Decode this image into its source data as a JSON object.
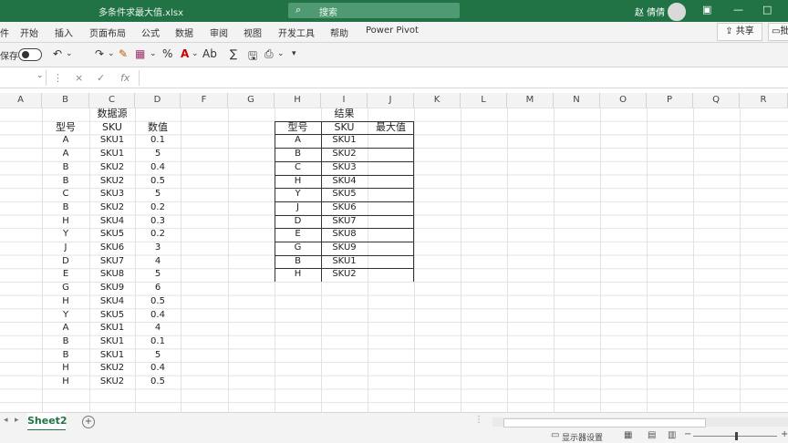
{
  "titlebar": {
    "filename": "多条件求最大值.xlsx",
    "search_placeholder": "搜索",
    "user_name": "赵 倩倩",
    "window_buttons": [
      "restore-icon",
      "minimize-icon",
      "maximize-icon"
    ]
  },
  "ribbon_tabs": [
    "件",
    "开始",
    "插入",
    "页面布局",
    "公式",
    "数据",
    "审阅",
    "视图",
    "开发工具",
    "帮助",
    "Power Pivot"
  ],
  "share_label": "共享",
  "comment_label": "批",
  "toolbar": {
    "autosave_label": "保存",
    "autosave_state": "off",
    "icons": [
      "undo-icon",
      "redo-icon",
      "format-painter-icon",
      "table-icon",
      "percent-icon",
      "font-color-icon",
      "text-style-icon",
      "sum-icon",
      "save-icon",
      "preview-icon",
      "customize-icon"
    ],
    "percent_label": "%",
    "sum_label": "∑"
  },
  "formula_bar": {
    "name_box": "",
    "cancel": "×",
    "enter": "✓",
    "fx": "fx",
    "formula": ""
  },
  "columns": [
    "A",
    "B",
    "C",
    "D",
    "F",
    "G",
    "H",
    "I",
    "J",
    "K",
    "L",
    "M",
    "N",
    "O",
    "P",
    "Q",
    "R"
  ],
  "source_table": {
    "title": "数据源",
    "headers": [
      "型号",
      "SKU",
      "数值"
    ],
    "rows": [
      [
        "A",
        "SKU1",
        "0.1"
      ],
      [
        "A",
        "SKU1",
        "5"
      ],
      [
        "B",
        "SKU2",
        "0.4"
      ],
      [
        "B",
        "SKU2",
        "0.5"
      ],
      [
        "C",
        "SKU3",
        "5"
      ],
      [
        "B",
        "SKU2",
        "0.2"
      ],
      [
        "H",
        "SKU4",
        "0.3"
      ],
      [
        "Y",
        "SKU5",
        "0.2"
      ],
      [
        "J",
        "SKU6",
        "3"
      ],
      [
        "D",
        "SKU7",
        "4"
      ],
      [
        "E",
        "SKU8",
        "5"
      ],
      [
        "G",
        "SKU9",
        "6"
      ],
      [
        "H",
        "SKU4",
        "0.5"
      ],
      [
        "Y",
        "SKU5",
        "0.4"
      ],
      [
        "A",
        "SKU1",
        "4"
      ],
      [
        "B",
        "SKU1",
        "0.1"
      ],
      [
        "B",
        "SKU1",
        "5"
      ],
      [
        "H",
        "SKU2",
        "0.4"
      ],
      [
        "H",
        "SKU2",
        "0.5"
      ]
    ]
  },
  "result_table": {
    "title": "结果",
    "headers": [
      "型号",
      "SKU",
      "最大值"
    ],
    "rows": [
      [
        "A",
        "SKU1",
        ""
      ],
      [
        "B",
        "SKU2",
        ""
      ],
      [
        "C",
        "SKU3",
        ""
      ],
      [
        "H",
        "SKU4",
        ""
      ],
      [
        "Y",
        "SKU5",
        ""
      ],
      [
        "J",
        "SKU6",
        ""
      ],
      [
        "D",
        "SKU7",
        ""
      ],
      [
        "E",
        "SKU8",
        ""
      ],
      [
        "G",
        "SKU9",
        ""
      ],
      [
        "B",
        "SKU1",
        ""
      ],
      [
        "H",
        "SKU2",
        ""
      ]
    ]
  },
  "sheet_tabs": [
    "Sheet2"
  ],
  "status": {
    "display_settings": "显示器设置"
  }
}
